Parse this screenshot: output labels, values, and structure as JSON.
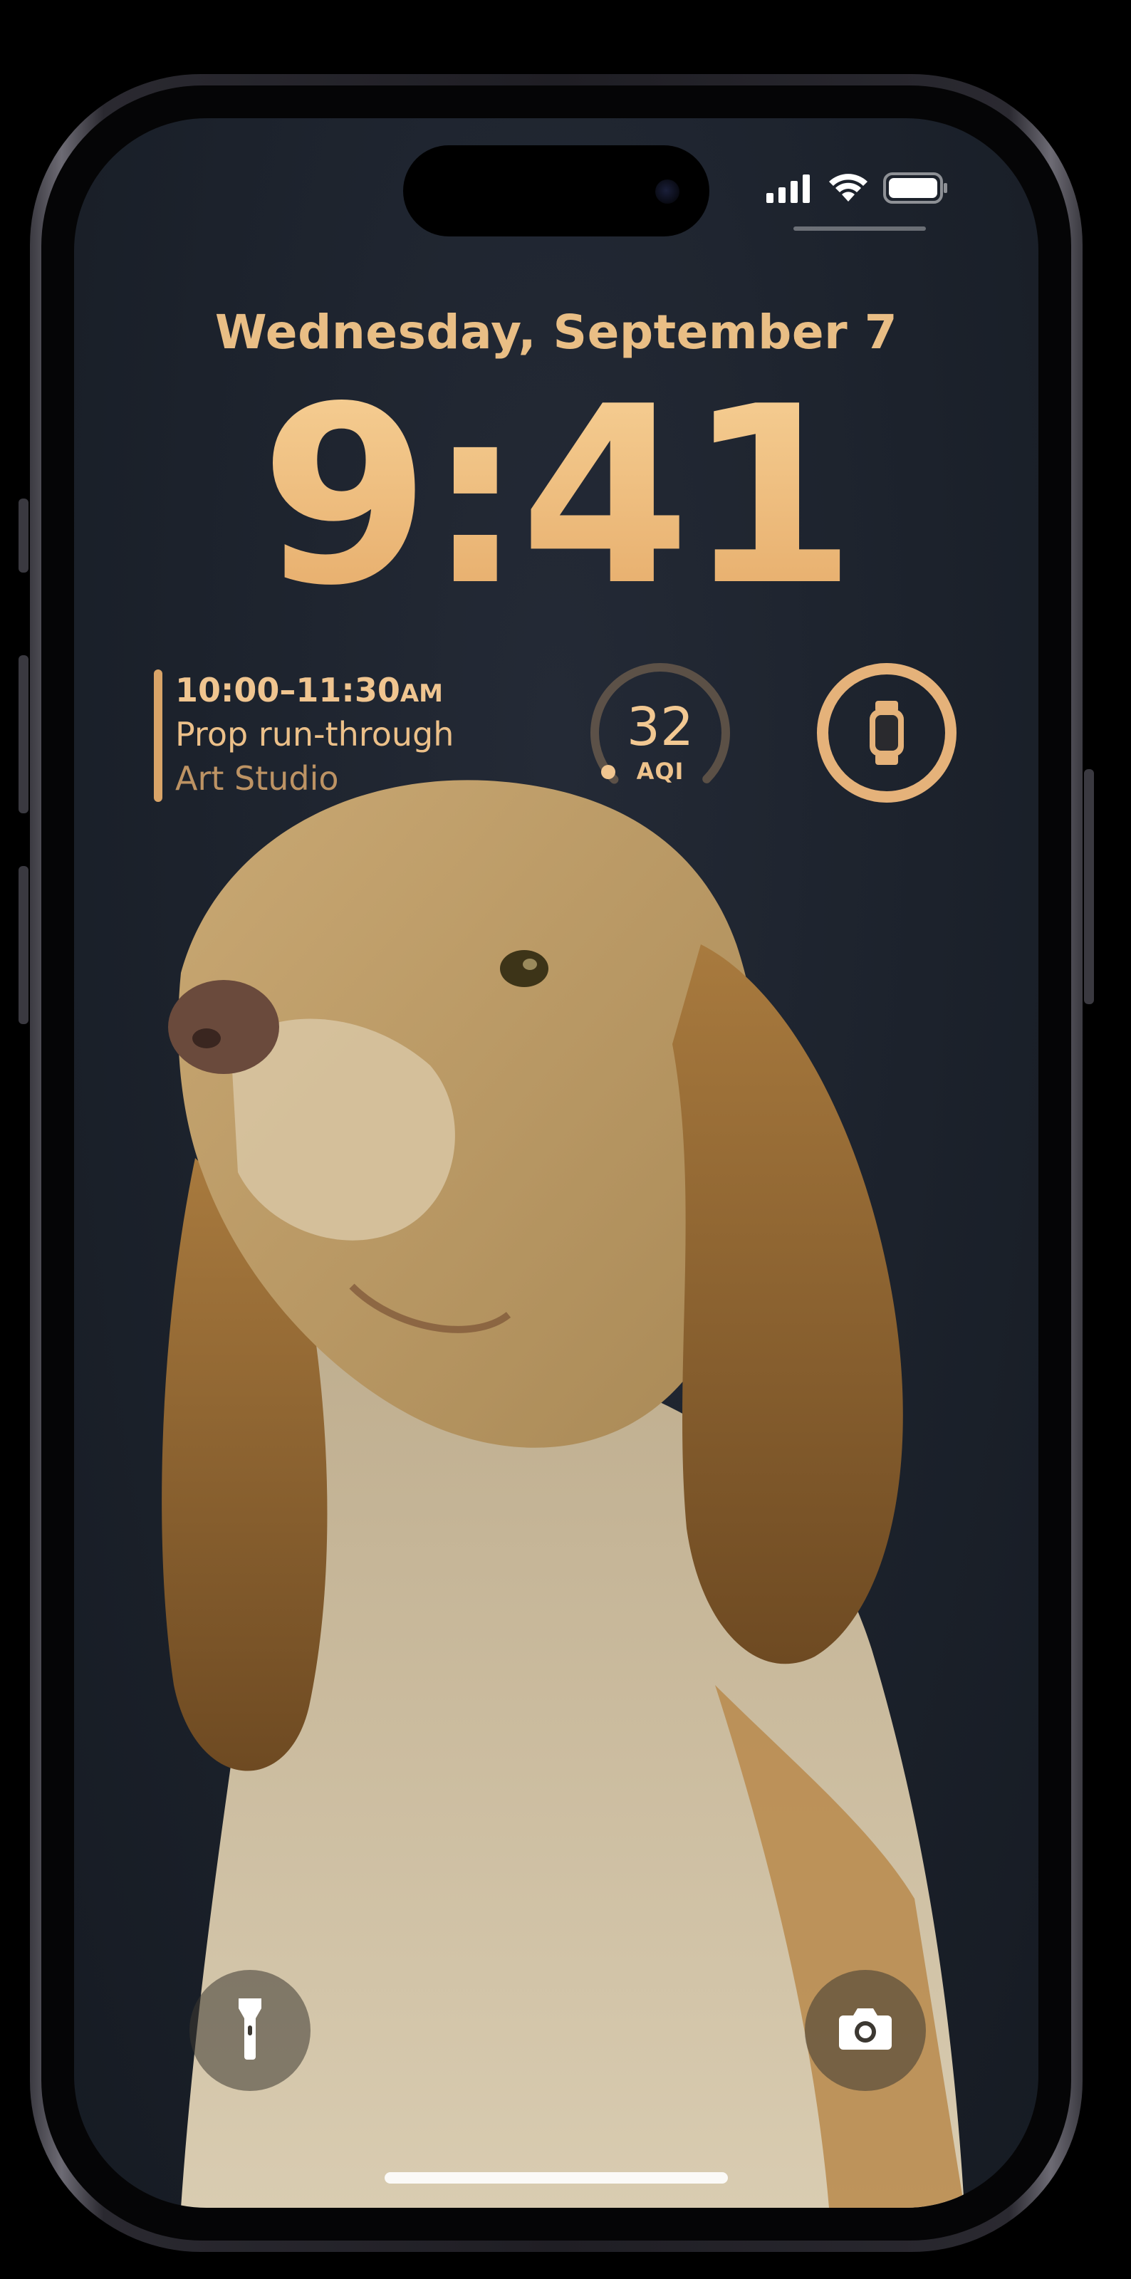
{
  "status_bar": {
    "icons": [
      "cellular-signal-icon",
      "wifi-icon",
      "battery-icon"
    ]
  },
  "lock_screen": {
    "date": "Wednesday, September 7",
    "time": "9:41"
  },
  "widgets": {
    "calendar": {
      "time_range": "10:00–11:30",
      "meridiem": "AM",
      "title": "Prop run-through",
      "location": "Art Studio"
    },
    "air_quality": {
      "value": "32",
      "label": "AQI"
    },
    "watch_battery": {
      "icon": "watch-icon"
    }
  },
  "quick_actions": {
    "left": "flashlight-icon",
    "right": "camera-icon"
  },
  "colors": {
    "accent": "#e8b77a",
    "background": "#1c222c"
  }
}
